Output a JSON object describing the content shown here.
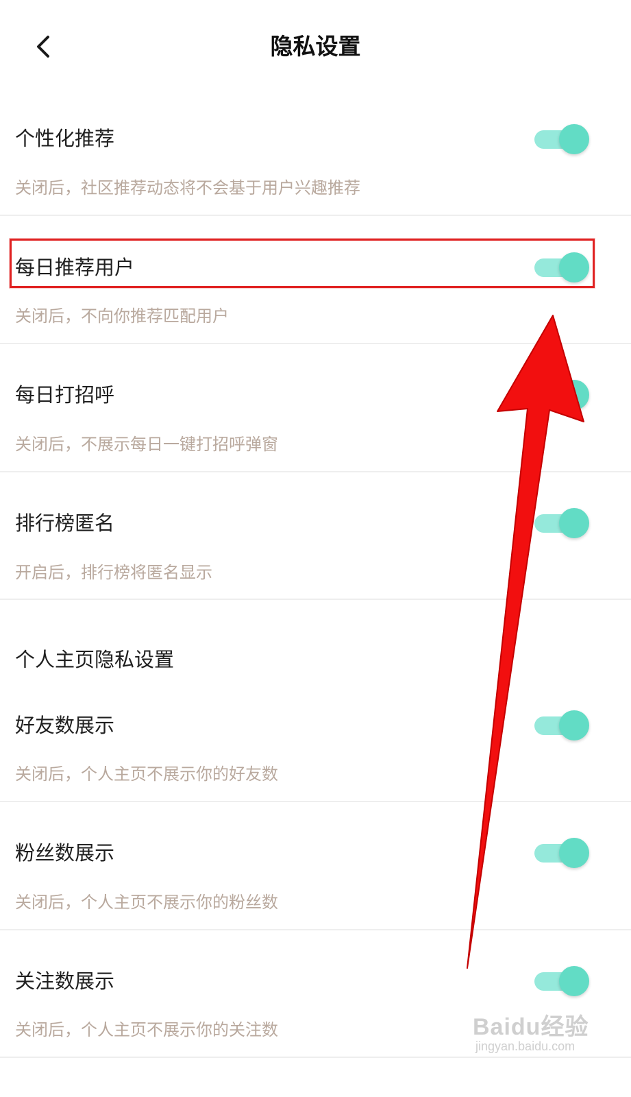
{
  "header": {
    "title": "隐私设置",
    "back_icon": "chevron-left-icon"
  },
  "colors": {
    "toggle_track": "#95e9db",
    "toggle_knob": "#62dcc5",
    "annotation_red": "#e02222",
    "desc_text": "#b9a99e"
  },
  "settings": [
    {
      "label": "个性化推荐",
      "desc": "关闭后，社区推荐动态将不会基于用户兴趣推荐",
      "enabled": true
    },
    {
      "label": "每日推荐用户",
      "desc": "关闭后，不向你推荐匹配用户",
      "enabled": true
    },
    {
      "label": "每日打招呼",
      "desc": "关闭后，不展示每日一键打招呼弹窗",
      "enabled": true
    },
    {
      "label": "排行榜匿名",
      "desc": "开启后，排行榜将匿名显示",
      "enabled": true
    }
  ],
  "profile_section": {
    "title": "个人主页隐私设置",
    "items": [
      {
        "label": "好友数展示",
        "desc": "关闭后，个人主页不展示你的好友数",
        "enabled": true
      },
      {
        "label": "粉丝数展示",
        "desc": "关闭后，个人主页不展示你的粉丝数",
        "enabled": true
      },
      {
        "label": "关注数展示",
        "desc": "关闭后，个人主页不展示你的关注数",
        "enabled": true
      }
    ]
  },
  "watermark": {
    "brand": "Baidu经验",
    "url": "jingyan.baidu.com"
  }
}
